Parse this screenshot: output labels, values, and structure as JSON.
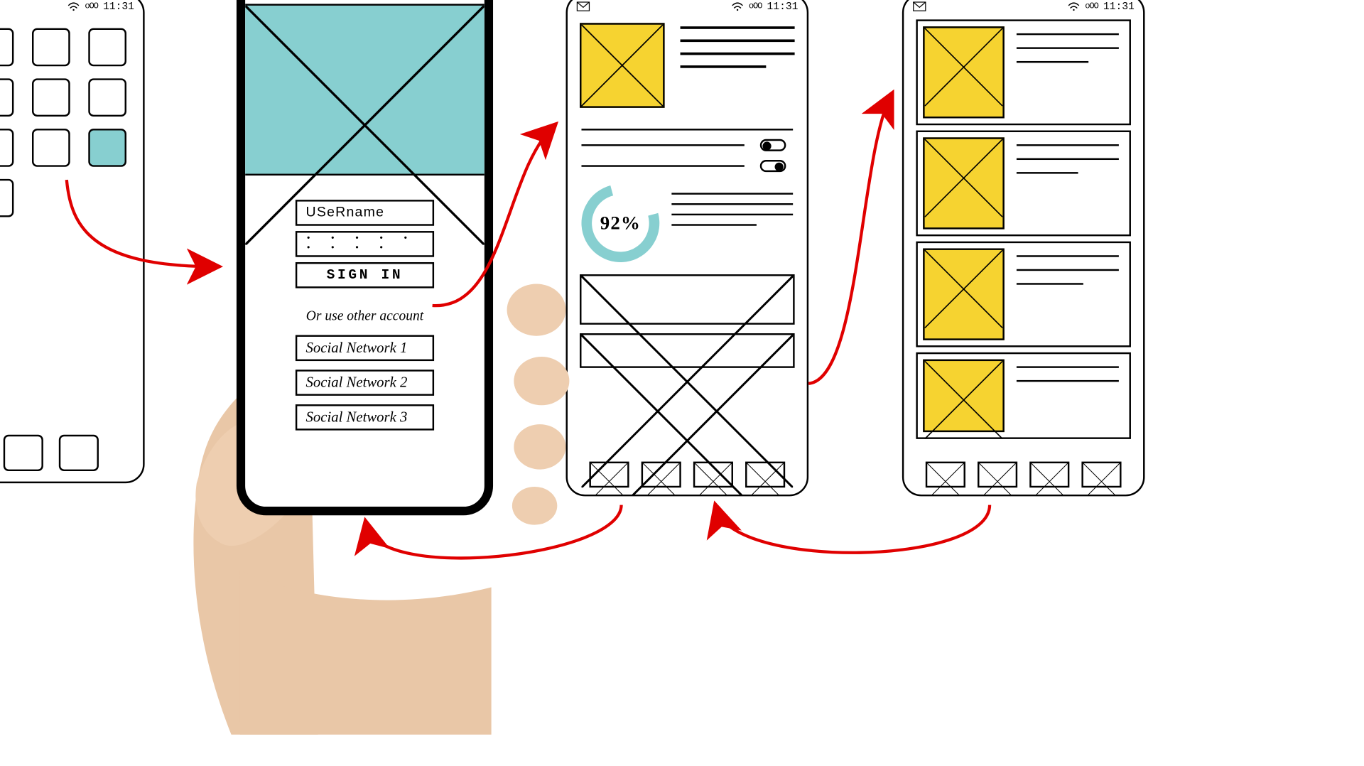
{
  "status": {
    "time": "11:31",
    "signal": "oOO",
    "mail_icon": "mail-icon",
    "wifi_icon": "wifi-icon"
  },
  "signin": {
    "username_label": "USeRname",
    "password_mask": "• • • • • • • • •",
    "signin_label": "SIGN IN",
    "alt_label": "Or use other account",
    "social": [
      "Social Network 1",
      "Social Network 2",
      "Social Network 3"
    ]
  },
  "dashboard": {
    "progress_pct": "92%",
    "toggles": [
      {
        "state": "off"
      },
      {
        "state": "on"
      }
    ]
  },
  "colors": {
    "teal": "#87cfd0",
    "yellow": "#f6d330",
    "arrow": "#e00000"
  }
}
